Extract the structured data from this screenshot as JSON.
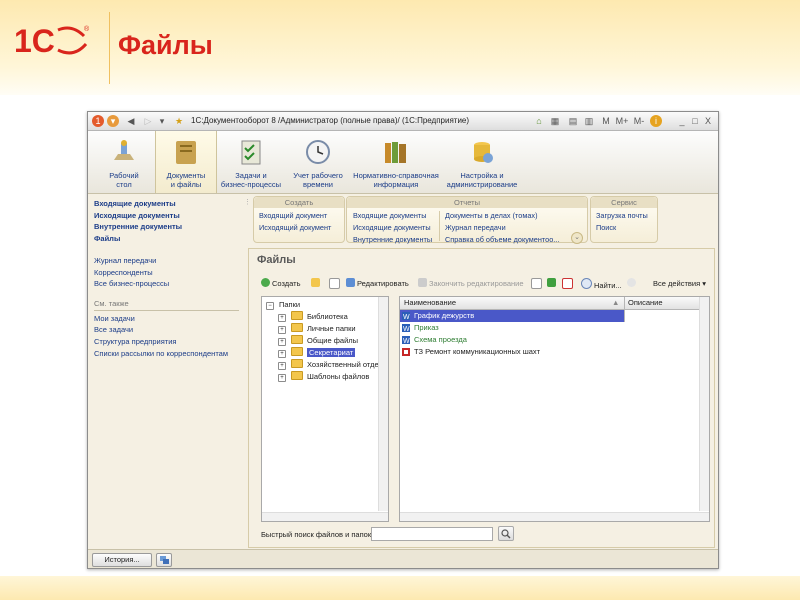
{
  "slide": {
    "title": "Файлы",
    "logo_text": "1С"
  },
  "window": {
    "title": "1С:Документооборот 8 /Администратор (полные права)/ (1С:Предприятие)",
    "controls": [
      "M",
      "M+",
      "M-",
      "i",
      "_",
      "□",
      "X"
    ]
  },
  "sections": [
    {
      "label1": "Рабочий",
      "label2": "стол",
      "icon": "desktop-icon"
    },
    {
      "label1": "Документы",
      "label2": "и файлы",
      "icon": "documents-icon"
    },
    {
      "label1": "Задачи и",
      "label2": "бизнес-процессы",
      "icon": "tasks-icon"
    },
    {
      "label1": "Учет рабочего",
      "label2": "времени",
      "icon": "clock-icon"
    },
    {
      "label1": "Нормативно-справочная",
      "label2": "информация",
      "icon": "books-icon"
    },
    {
      "label1": "Настройка и",
      "label2": "администрирование",
      "icon": "settings-icon"
    }
  ],
  "nav": {
    "main": [
      "Входящие документы",
      "Исходящие документы",
      "Внутренние документы",
      "Файлы"
    ],
    "secondary": [
      "Журнал передачи",
      "Корреспонденты",
      "Все бизнес-процессы"
    ],
    "see_also_title": "См. также",
    "see_also": [
      "Мои задачи",
      "Все задачи",
      "Структура предприятия",
      "Списки рассылки по корреспондентам"
    ]
  },
  "actions": {
    "create": {
      "title": "Создать",
      "items": [
        "Входящий документ",
        "Исходящий документ"
      ]
    },
    "reports": {
      "title": "Отчеты",
      "col1": [
        "Входящие документы",
        "Исходящие документы",
        "Внутренние документы"
      ],
      "col2": [
        "Документы в делах (томах)",
        "Журнал передачи",
        "Справка об объеме документоо..."
      ]
    },
    "service": {
      "title": "Сервис",
      "items": [
        "Загрузка почты",
        "Поиск"
      ]
    }
  },
  "files_panel": {
    "title": "Файлы",
    "toolbar": {
      "create": "Создать",
      "edit": "Редактировать",
      "finish_edit": "Закончить редактирование",
      "find": "Найти...",
      "all_actions": "Все действия"
    },
    "tree": {
      "root": "Папки",
      "folders": [
        "Библиотека",
        "Личные папки",
        "Общие файлы",
        "Секретариат",
        "Хозяйственный отдел",
        "Шаблоны файлов"
      ],
      "selected": "Секретариат"
    },
    "table": {
      "columns": [
        "Наименование",
        "Описание"
      ],
      "rows": [
        {
          "name": "График дежурств",
          "description": "",
          "type": "word"
        },
        {
          "name": "Приказ",
          "description": "",
          "type": "word"
        },
        {
          "name": "Схема проезда",
          "description": "",
          "type": "word"
        },
        {
          "name": "ТЗ Ремонт коммуникационных шахт",
          "description": "",
          "type": "pdf"
        }
      ]
    },
    "search_label": "Быстрый поиск файлов и папок:",
    "search_value": ""
  },
  "status": {
    "history_button": "История..."
  },
  "colors": {
    "brand_red": "#d9251c",
    "link_blue": "#1b3c88",
    "selection": "#4a58c8",
    "file_green": "#2e7d32"
  }
}
